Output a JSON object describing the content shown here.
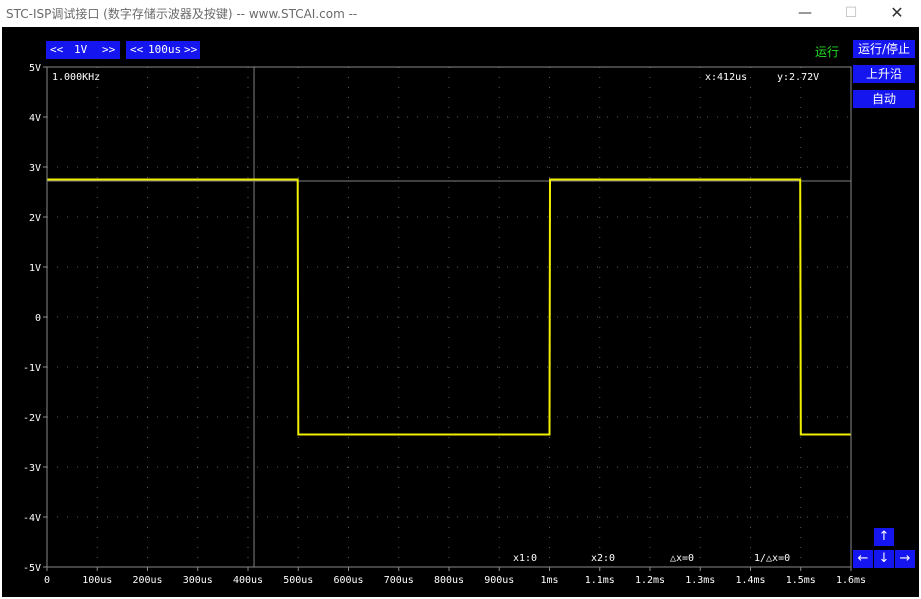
{
  "window": {
    "title": "STC-ISP调试接口 (数字存储示波器及按键) -- www.STCAI.com --",
    "min_glyph": "—",
    "max_glyph": "☐",
    "close_glyph": "✕"
  },
  "toolbar": {
    "volt_dec": "<<",
    "volt_value": "1V",
    "volt_inc": ">>",
    "time_dec": "<<",
    "time_value": "100us",
    "time_inc": ">>"
  },
  "side": {
    "status": "运行",
    "run_stop": "运行/停止",
    "trigger_edge": "上升沿",
    "auto": "自动"
  },
  "readouts": {
    "frequency": "1.000KHz",
    "cursor_x": "x:412us",
    "cursor_y": "y:2.72V",
    "x1": "x1:0",
    "x2": "x2:0",
    "dx": "△x=0",
    "inv_dx": "1/△x=0"
  },
  "arrows": {
    "up": "↑",
    "left": "←",
    "down": "↓",
    "right": "→"
  },
  "colors": {
    "background": "#000000",
    "grid": "#5a5a5a",
    "trace": "#f0f000",
    "button": "#1515f0",
    "status": "#22dd22"
  },
  "chart_data": {
    "type": "line",
    "y_ticks": [
      "5V",
      "4V",
      "3V",
      "2V",
      "1V",
      "0",
      "-1V",
      "-2V",
      "-3V",
      "-4V",
      "-5V"
    ],
    "x_ticks": [
      "0",
      "100us",
      "200us",
      "300us",
      "400us",
      "500us",
      "600us",
      "700us",
      "800us",
      "900us",
      "1ms",
      "1.1ms",
      "1.2ms",
      "1.3ms",
      "1.4ms",
      "1.5ms",
      "1.6ms"
    ],
    "xlim": [
      0,
      1600
    ],
    "ylim": [
      -5,
      5
    ],
    "x_unit": "us",
    "y_unit": "V",
    "cursor": {
      "x": 412,
      "y": 2.72
    },
    "series": [
      {
        "x": [
          0,
          499,
          500,
          1000,
          1001,
          1499,
          1500,
          1600
        ],
        "y": [
          2.75,
          2.75,
          -2.35,
          -2.35,
          2.75,
          2.75,
          -2.35,
          -2.35
        ]
      }
    ]
  }
}
